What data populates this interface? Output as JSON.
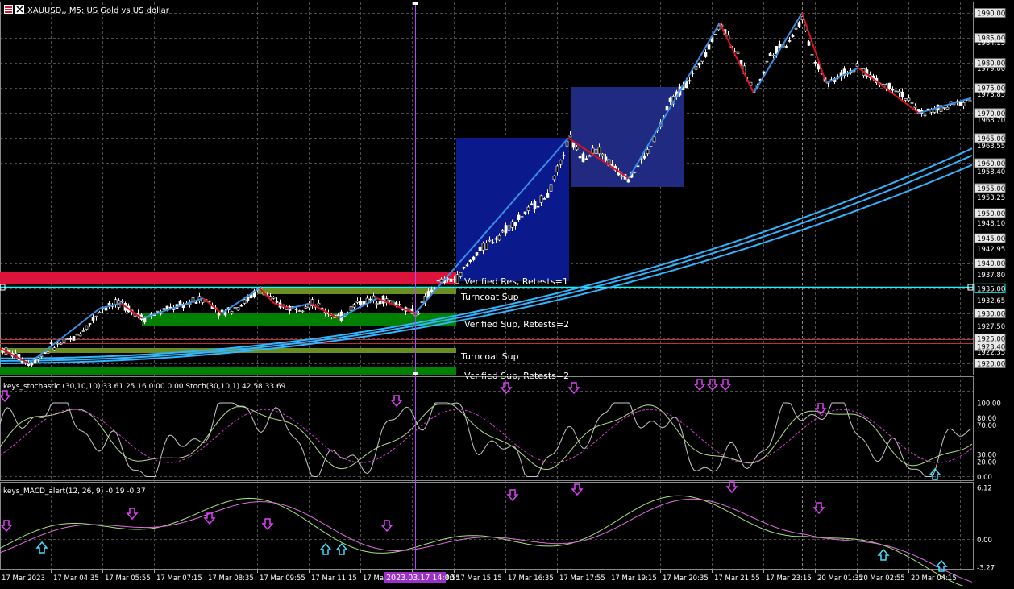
{
  "window": {
    "title": "XAUUSD,, M5: US Gold vs US dollar",
    "icon": "chart-window-icon"
  },
  "colors": {
    "background": "#000000",
    "grid": "#4d4d4d",
    "axis_text": "#ffffff",
    "candle": "#ffffff",
    "zigzag_up": "#3a8ee6",
    "zigzag_down": "#e0101e",
    "ma": "#33b4ff",
    "resistance_zone": "#dc143c",
    "support_zone": "#008000",
    "turncoat_zone": "#6b8e23",
    "box_dark": "#0a1a8c",
    "box_light": "#1f2a80",
    "cursor": "#b444ff",
    "level_line": "#00ffff",
    "stoch_main": "#c8c8c8",
    "stoch_signal": "#b0e08a",
    "stoch_signal2": "#d43fd4",
    "macd_main": "#a6e37a",
    "macd_signal": "#e06fe0",
    "arrow_down": "#e040fb",
    "arrow_up": "#40e0ff"
  },
  "main_panel": {
    "price_labels": [
      "1990.00",
      "1985.00",
      "1984.15",
      "1979.00",
      "1980.00",
      "1975.00",
      "1973.85",
      "1970.00",
      "1968.70",
      "1965.00",
      "1963.55",
      "1960.00",
      "1958.40",
      "1955.00",
      "1953.25",
      "1950.00",
      "1948.10",
      "1945.00",
      "1942.95",
      "1940.00",
      "1937.80",
      "1935.00",
      "1932.65",
      "1930.00",
      "1927.50",
      "1925.00",
      "1923.40",
      "1922.35",
      "1920.00"
    ],
    "zone_labels": {
      "verified_res": "Verified Res, Retests=1",
      "turncoat_sup_1": "Turncoat Sup",
      "verified_sup": "Verified Sup, Retests=2",
      "turncoat_sup_2": "Turncoat Sup",
      "verified_sup_2": "Verified Sup, Retests=2"
    }
  },
  "stoch_panel": {
    "title": "keys_stochastic (30,10,10) 33.61 25.16 0.00 0.00 Stoch(30,10,1) 42.58 33.69",
    "levels": [
      "100.00",
      "80.00",
      "70.00",
      "30.00",
      "20.00",
      "0.00"
    ]
  },
  "macd_panel": {
    "title": "keys_MACD_alert(12, 26, 9) -0.19 -0.37",
    "levels": [
      "6.12",
      "0.00",
      "-3.27"
    ]
  },
  "time_axis": {
    "labels": [
      "17 Mar 2023",
      "17 Mar 04:35",
      "17 Mar 05:55",
      "17 Mar 07:15",
      "17 Mar 08:35",
      "17 Mar 09:55",
      "17 Mar 11:15",
      "17 Mar 12:35",
      "17 Mar 13:55",
      "17 Mar 15:15",
      "17 Mar 16:35",
      "17 Mar 17:55",
      "17 Mar 19:15",
      "17 Mar 20:35",
      "17 Mar 21:55",
      "17 Mar 23:15",
      "20 Mar 01:35",
      "20 Mar 02:55",
      "20 Mar 04:15"
    ],
    "cursor_label": "2023.03.17 14:00"
  }
}
